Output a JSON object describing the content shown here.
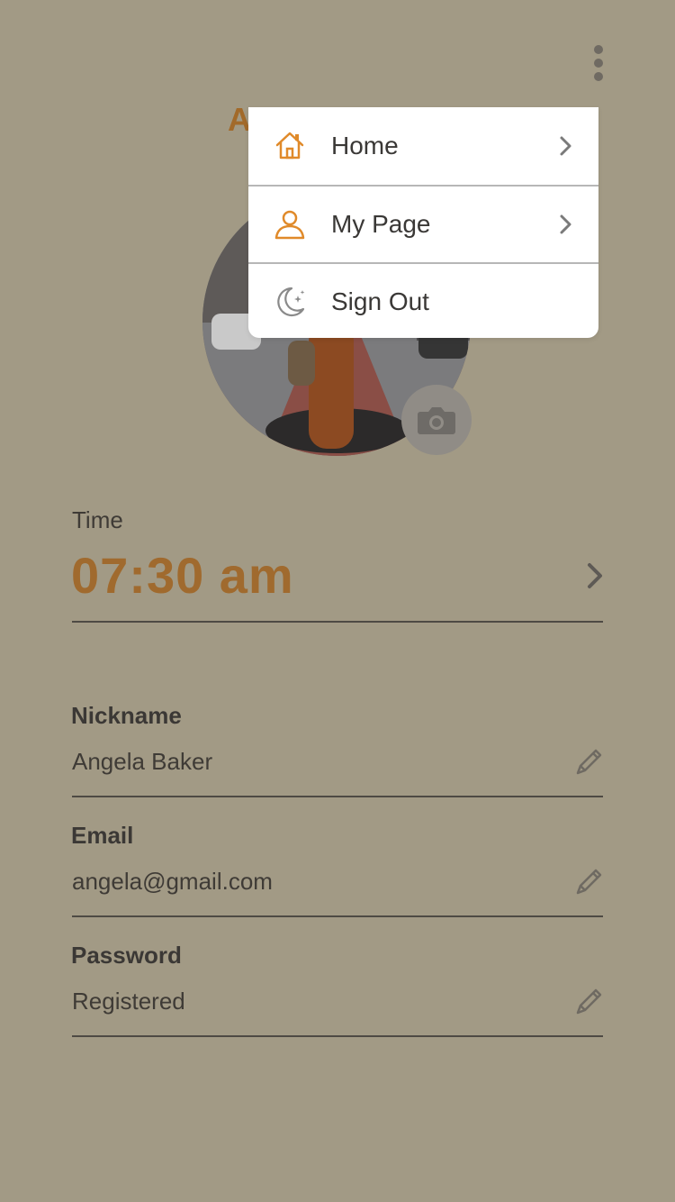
{
  "header": {
    "menu_icon": "more-vertical-icon",
    "profile_name_partial": "A"
  },
  "profile": {
    "camera_icon": "camera-icon"
  },
  "time": {
    "label": "Time",
    "value": "07:30 am"
  },
  "fields": [
    {
      "label": "Nickname",
      "value": "Angela Baker",
      "icon": "pencil-icon"
    },
    {
      "label": "Email",
      "value": "angela@gmail.com",
      "icon": "pencil-icon"
    },
    {
      "label": "Password",
      "value": "Registered",
      "icon": "pencil-icon"
    }
  ],
  "menu": {
    "items": [
      {
        "label": "Home",
        "icon": "home-icon"
      },
      {
        "label": "My Page",
        "icon": "user-icon"
      },
      {
        "label": "Sign Out",
        "icon": "moon-icon"
      }
    ]
  },
  "colors": {
    "background": "#a29a85",
    "accent": "#a06a2e",
    "menu_icon_accent": "#e08a2a",
    "text": "#3f3b36"
  }
}
